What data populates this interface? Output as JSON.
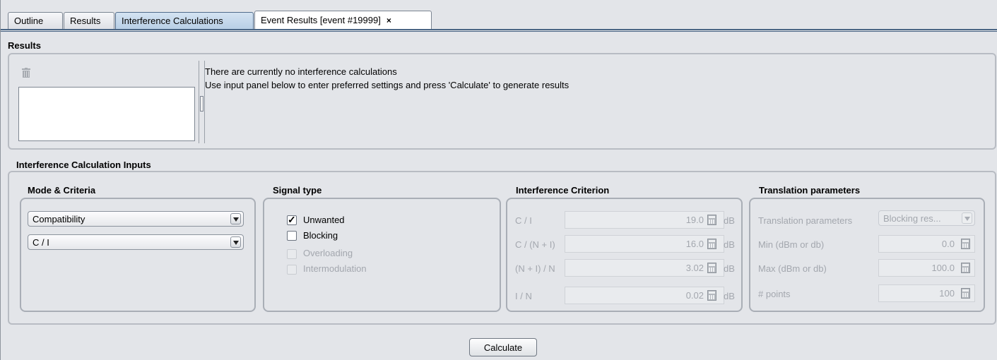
{
  "tabs": [
    {
      "label": "Outline",
      "active": false
    },
    {
      "label": "Results",
      "active": false
    },
    {
      "label": "Interference Calculations",
      "active": true
    },
    {
      "label": "Event Results [event #19999]",
      "active": false,
      "closable": true
    }
  ],
  "close_glyph": "×",
  "results": {
    "title": "Results",
    "trash_icon": "trash-icon",
    "message_line1": "There are currently no interference calculations",
    "message_line2": "Use input panel below to enter preferred settings and press 'Calculate' to generate results"
  },
  "inputs": {
    "title": "Interference Calculation Inputs",
    "mode": {
      "title": "Mode & Criteria",
      "mode_value": "Compatibility",
      "criteria_value": "C / I"
    },
    "signal": {
      "title": "Signal type",
      "items": [
        {
          "label": "Unwanted",
          "checked": true,
          "enabled": true
        },
        {
          "label": "Blocking",
          "checked": false,
          "enabled": true
        },
        {
          "label": "Overloading",
          "checked": false,
          "enabled": false
        },
        {
          "label": "Intermodulation",
          "checked": false,
          "enabled": false
        }
      ]
    },
    "criterion": {
      "title": "Interference Criterion",
      "rows": [
        {
          "label": "C / I",
          "value": "19.0",
          "unit": "dB"
        },
        {
          "label": "C / (N + I)",
          "value": "16.0",
          "unit": "dB"
        },
        {
          "label": "(N + I) / N",
          "value": "3.02",
          "unit": "dB"
        },
        {
          "label": "I / N",
          "value": "0.02",
          "unit": "dB"
        }
      ]
    },
    "translation": {
      "title": "Translation parameters",
      "param_label": "Translation parameters",
      "param_value": "Blocking res...",
      "rows": [
        {
          "label": "Min (dBm or db)",
          "value": "0.0"
        },
        {
          "label": "Max (dBm or db)",
          "value": "100.0"
        },
        {
          "label": "# points",
          "value": "100"
        }
      ]
    }
  },
  "calculate_label": "Calculate",
  "check_glyph": "✓"
}
